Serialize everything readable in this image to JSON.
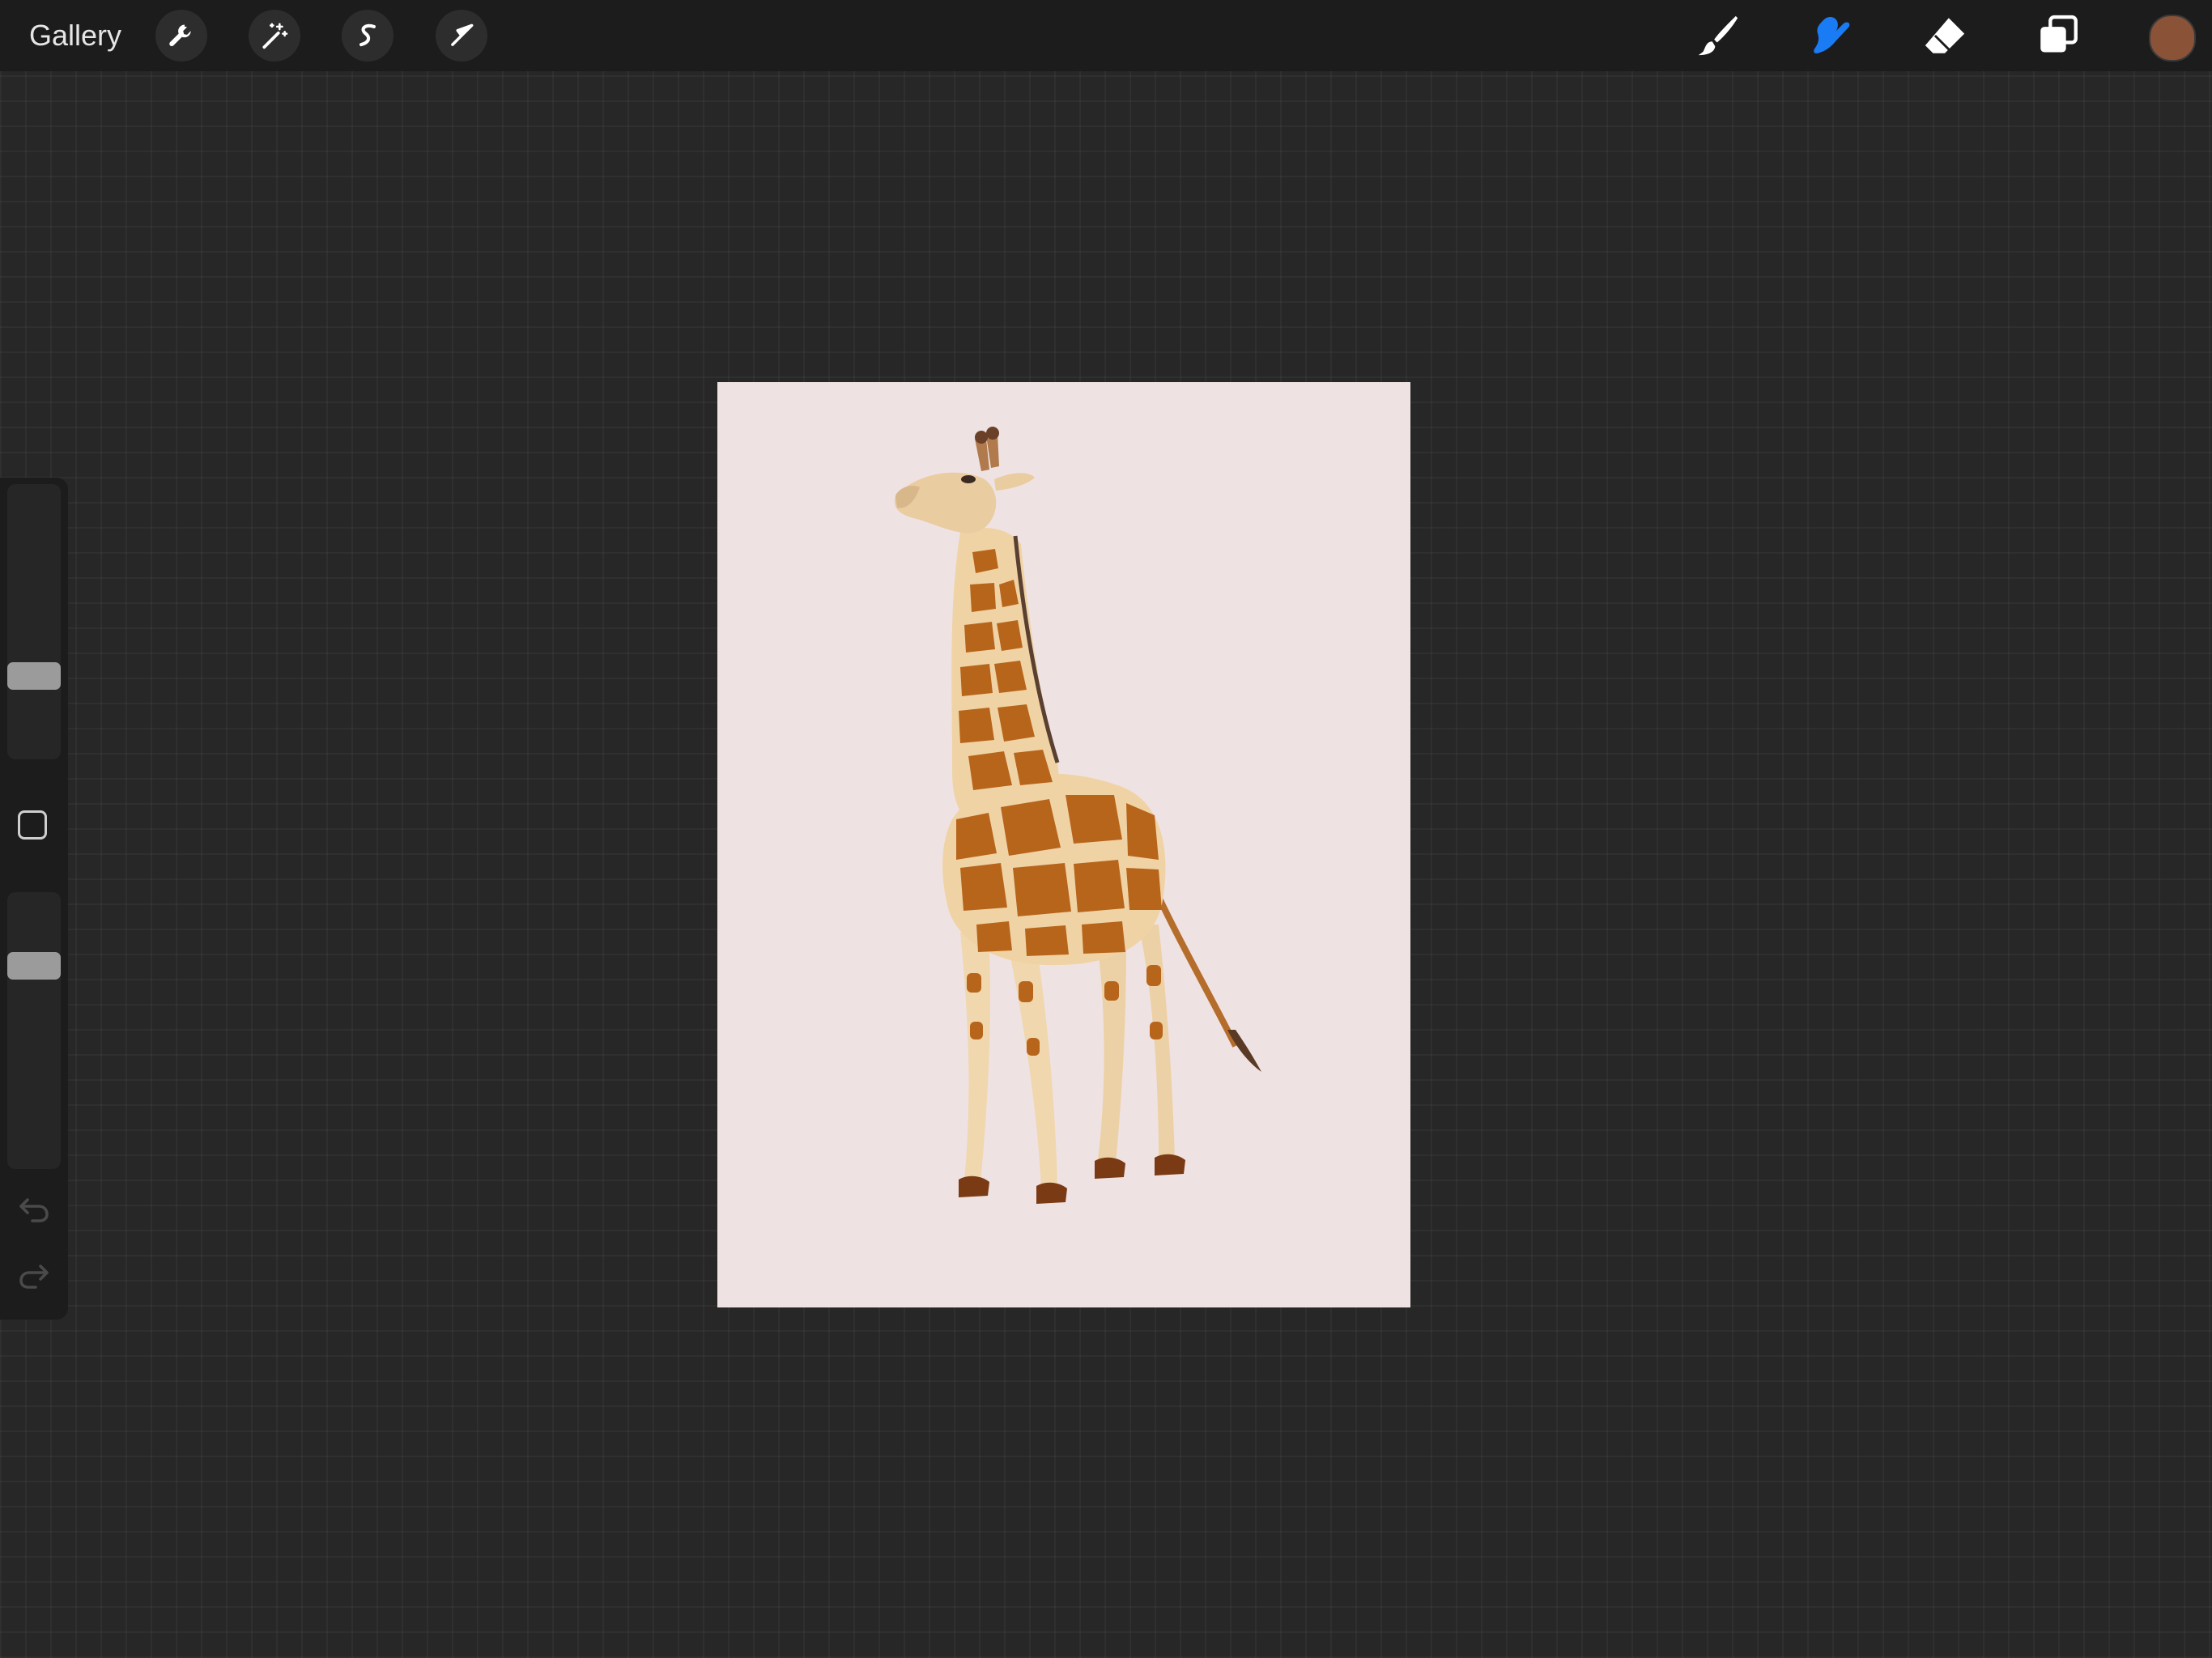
{
  "toolbar": {
    "gallery_label": "Gallery",
    "left_tools": [
      {
        "name": "actions",
        "icon": "wrench-icon"
      },
      {
        "name": "adjustments",
        "icon": "magic-wand-icon"
      },
      {
        "name": "selection",
        "icon": "selection-s-icon"
      },
      {
        "name": "transform",
        "icon": "arrow-cursor-icon"
      }
    ],
    "right_tools": [
      {
        "name": "brush",
        "icon": "brush-icon",
        "active": false
      },
      {
        "name": "smudge",
        "icon": "smudge-icon",
        "active": true
      },
      {
        "name": "eraser",
        "icon": "eraser-icon",
        "active": false
      },
      {
        "name": "layers",
        "icon": "layers-icon",
        "active": false
      }
    ],
    "active_tool_color": "#1a7cf5",
    "current_color": "#8a5236"
  },
  "sidebar": {
    "brush_size_level": 0.28,
    "opacity_level": 0.76,
    "modify_icon": "square-icon",
    "undo_icon": "undo-icon",
    "redo_icon": "redo-icon"
  },
  "canvas": {
    "background_color": "#efe2e3",
    "artwork": "giraffe-illustration"
  }
}
